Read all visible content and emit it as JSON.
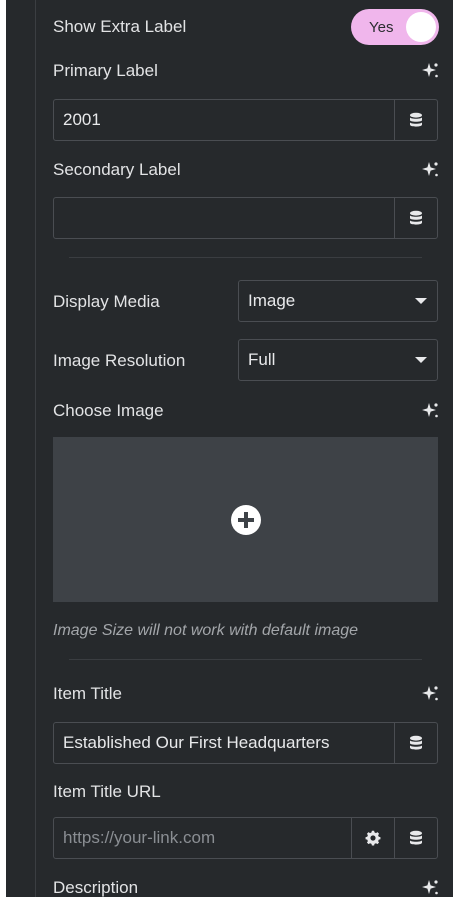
{
  "show_extra_label": {
    "label": "Show Extra Label",
    "toggle_text": "Yes",
    "enabled": true
  },
  "primary_label": {
    "label": "Primary Label",
    "value": "2001"
  },
  "secondary_label": {
    "label": "Secondary Label",
    "value": ""
  },
  "display_media": {
    "label": "Display Media",
    "selected": "Image"
  },
  "image_resolution": {
    "label": "Image Resolution",
    "selected": "Full"
  },
  "choose_image": {
    "label": "Choose Image",
    "note": "Image Size will not work with default image"
  },
  "item_title": {
    "label": "Item Title",
    "value": "Established Our First Headquarters"
  },
  "item_title_url": {
    "label": "Item Title URL",
    "placeholder": "https://your-link.com",
    "value": ""
  },
  "description": {
    "label": "Description"
  },
  "colors": {
    "panel_bg": "#26292c",
    "toggle_on": "#f0b6ec",
    "field_border": "#4a4d52",
    "media_bg": "#3e4247"
  },
  "icons": {
    "ai": "sparkle-ai-icon",
    "dynamic": "database-icon",
    "settings": "gear-icon",
    "add": "plus-circle-icon",
    "dropdown": "caret-down-icon"
  }
}
